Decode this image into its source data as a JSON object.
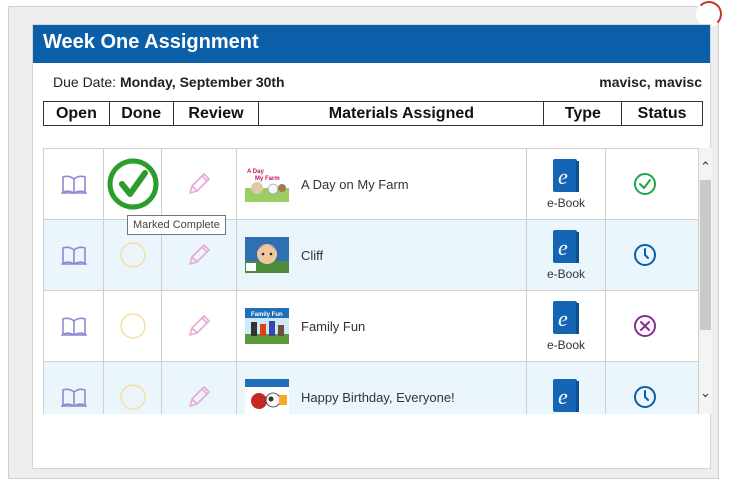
{
  "panel": {
    "title": "Week One Assignment",
    "due_label": "Due Date: ",
    "due_value": "Monday, September 30th",
    "user": "mavisc, mavisc"
  },
  "columns": {
    "open": "Open",
    "done": "Done",
    "review": "Review",
    "materials": "Materials Assigned",
    "type": "Type",
    "status": "Status"
  },
  "rows": [
    {
      "title": "A Day on My Farm",
      "type": "e-Book",
      "done": true,
      "status": "complete"
    },
    {
      "title": "Cliff",
      "type": "e-Book",
      "done": false,
      "status": "pending"
    },
    {
      "title": "Family Fun",
      "type": "e-Book",
      "done": false,
      "status": "incomplete"
    },
    {
      "title": "Happy Birthday, Everyone!",
      "type": "",
      "done": false,
      "status": "pending"
    }
  ],
  "tooltip": "Marked Complete",
  "thumb_text": {
    "farm_line1": "A Day",
    "farm_line2": "My Farm",
    "family": "Family Fun"
  },
  "colors": {
    "title_bar": "#0b5ea8",
    "done_green": "#2b9d2b",
    "status_green": "#22a24a",
    "status_blue": "#0b5ea8",
    "status_purple": "#8a2c9a",
    "alt_row": "#eaf5fc"
  },
  "icons": {
    "open": "book-open-icon",
    "review": "pencil-icon",
    "type": "ebook-icon",
    "status_complete": "check-circle-icon",
    "status_pending": "clock-icon",
    "status_incomplete": "x-circle-icon"
  }
}
